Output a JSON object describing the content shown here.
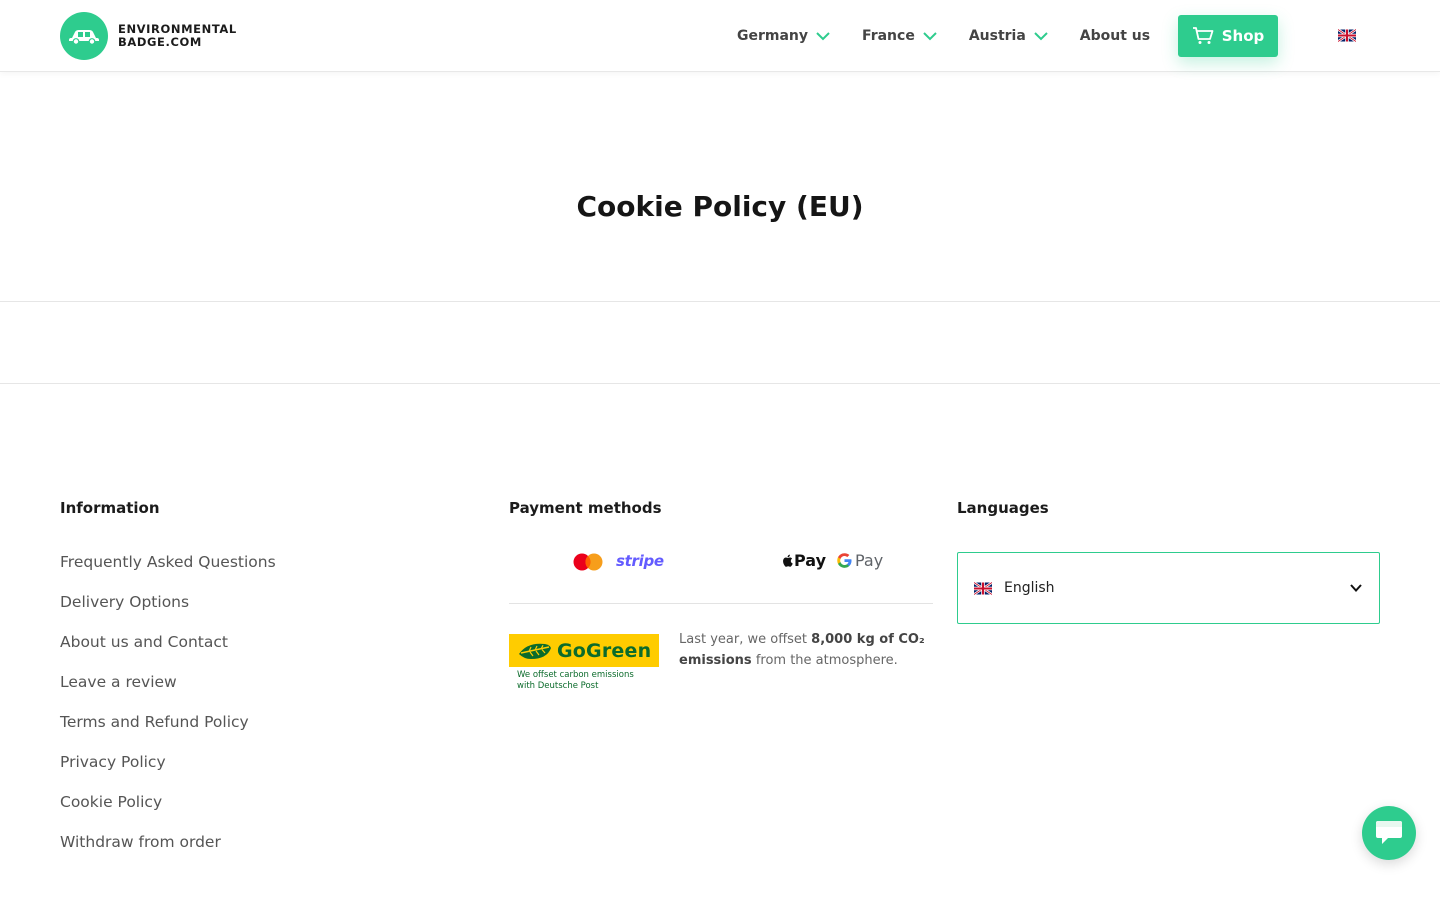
{
  "header": {
    "logo_line1": "ENVIRONMENTAL",
    "logo_line2": "BADGE.COM",
    "nav": [
      {
        "label": "Germany",
        "dropdown": true
      },
      {
        "label": "France",
        "dropdown": true
      },
      {
        "label": "Austria",
        "dropdown": true
      },
      {
        "label": "About us",
        "dropdown": false
      }
    ],
    "shop_label": "Shop",
    "language_flag": "uk-flag-icon"
  },
  "page": {
    "title": "Cookie Policy (EU)"
  },
  "footer": {
    "information": {
      "title": "Information",
      "links": [
        "Frequently Asked Questions",
        "Delivery Options",
        "About us and Contact",
        "Leave a review",
        "Terms and Refund Policy",
        "Privacy Policy",
        "Cookie Policy",
        "Withdraw from order"
      ]
    },
    "payment": {
      "title": "Payment methods",
      "stripe": "stripe",
      "apple_pay": "Pay",
      "google_pay": "Pay"
    },
    "gogreen": {
      "logo_word": "GoGreen",
      "sub_line1": "We offset carbon emissions",
      "sub_line2": "with Deutsche Post",
      "text_before": "Last year, we offset ",
      "text_bold": "8,000 kg of CO₂ emissions",
      "text_after": " from the atmosphere."
    },
    "languages": {
      "title": "Languages",
      "selected": "English"
    }
  },
  "colors": {
    "accent": "#2ecc8e",
    "gogreen_yellow": "#ffcc00",
    "gogreen_green": "#0b6b2b",
    "stripe_purple": "#635bff"
  }
}
